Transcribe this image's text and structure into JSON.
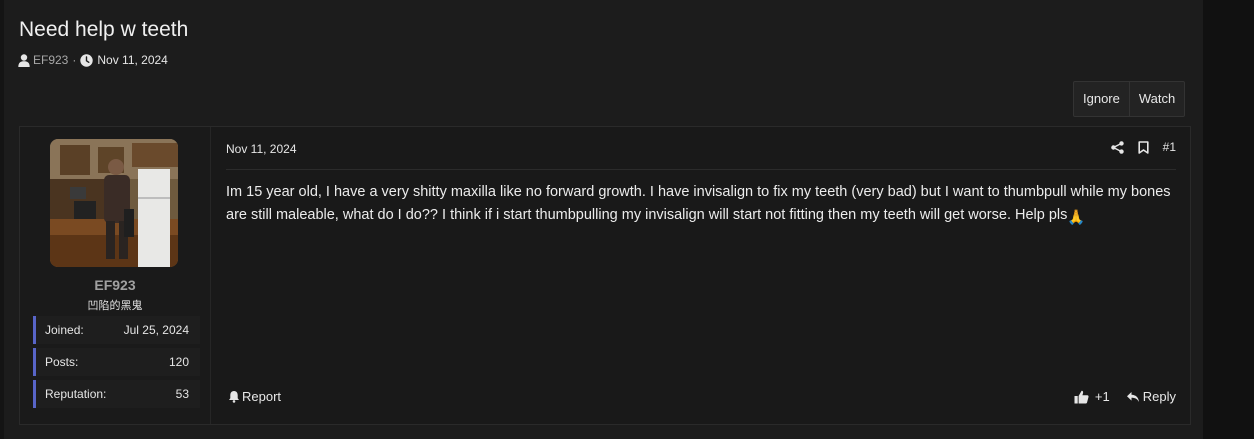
{
  "thread": {
    "title": "Need help w teeth",
    "author": "EF923",
    "separator": "·",
    "date": "Nov 11, 2024"
  },
  "thread_buttons": {
    "ignore": "Ignore",
    "watch": "Watch"
  },
  "post": {
    "date": "Nov 11, 2024",
    "number": "#1",
    "body": "Im 15 year old, I have a very shitty maxilla like no forward growth. I have invisalign to fix my teeth (very bad) but I want to thumbpull while my bones are still maleable, what do I do?? I think if i start thumbpulling my invisalign will start not fitting then my teeth will get worse. Help pls",
    "emoji": "🙏",
    "report_label": "Report",
    "like_count": "+1",
    "reply_label": "Reply"
  },
  "user": {
    "name": "EF923",
    "title": "凹陷的黑鬼",
    "stats": [
      {
        "label": "Joined:",
        "value": "Jul 25, 2024"
      },
      {
        "label": "Posts:",
        "value": "120"
      },
      {
        "label": "Reputation:",
        "value": "53"
      }
    ]
  },
  "colors": {
    "accent_stat_border": "#5865c8",
    "username": "#a0a0a0"
  },
  "icons": [
    "user-icon",
    "clock-icon",
    "share-icon",
    "bookmark-icon",
    "bell-icon",
    "thumbs-up-icon",
    "reply-icon"
  ]
}
